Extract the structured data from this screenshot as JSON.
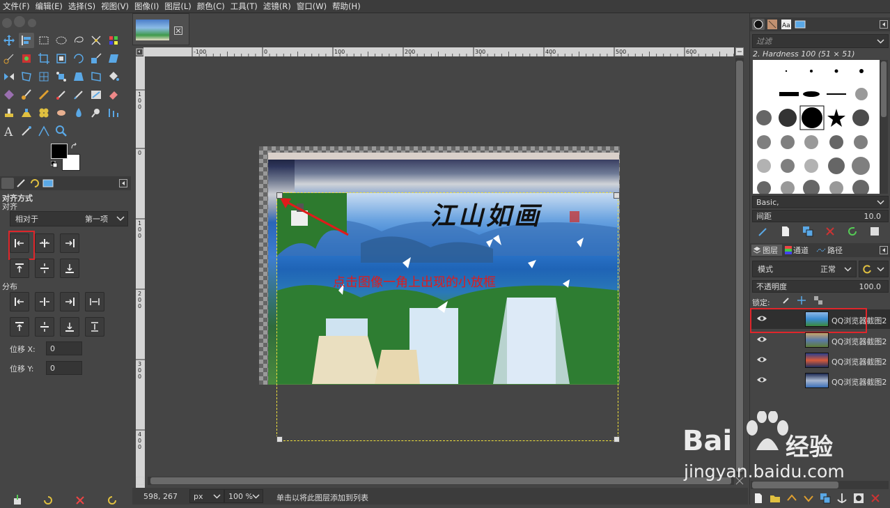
{
  "menu": [
    "文件(F)",
    "编辑(E)",
    "选择(S)",
    "视图(V)",
    "图像(I)",
    "图层(L)",
    "颜色(C)",
    "工具(T)",
    "滤镜(R)",
    "窗口(W)",
    "帮助(H)"
  ],
  "tool_options": {
    "title": "对齐方式",
    "align_label": "对齐",
    "relative_to_label": "相对于",
    "relative_to_value": "第一项",
    "distribute_label": "分布",
    "offset_x_label": "位移 X:",
    "offset_x_value": "0",
    "offset_y_label": "位移 Y:",
    "offset_y_value": "0"
  },
  "ruler": {
    "h_ticks": [
      "-100",
      "0",
      "100",
      "200",
      "300",
      "400",
      "500",
      "600"
    ],
    "v_ticks": [
      "1\n0\n0",
      "0",
      "1\n0\n0",
      "2\n0\n0",
      "3\n0\n0",
      "4\n0\n0"
    ]
  },
  "image": {
    "calligraphy": "江山如画",
    "annotation": "点击图像一角上出现的小放框"
  },
  "statusbar": {
    "coords": "598, 267",
    "unit": "px",
    "zoom": "100 %",
    "message": "单击以将此图层添加到列表"
  },
  "brushes": {
    "filter_placeholder": "过滤",
    "brush_name": "2. Hardness 100 (51 × 51)",
    "tag": "Basic,",
    "spacing_label": "间距",
    "spacing_value": "10.0"
  },
  "layers_panel": {
    "tabs": [
      "图层",
      "通道",
      "路径"
    ],
    "mode_label": "模式",
    "mode_value": "正常",
    "opacity_label": "不透明度",
    "opacity_value": "100.0",
    "lock_label": "锁定:",
    "layers": [
      {
        "name": "QQ浏览器截图2"
      },
      {
        "name": "QQ浏览器截图2"
      },
      {
        "name": "QQ浏览器截图2"
      },
      {
        "name": "QQ浏览器截图2"
      }
    ]
  },
  "watermark": {
    "brand": "Bai",
    "brand2": "经验",
    "url": "jingyan.baidu.com"
  },
  "colors": {
    "highlight": "#e0262b",
    "annotation": "#e01b1b",
    "selection": "#f2e23c"
  }
}
